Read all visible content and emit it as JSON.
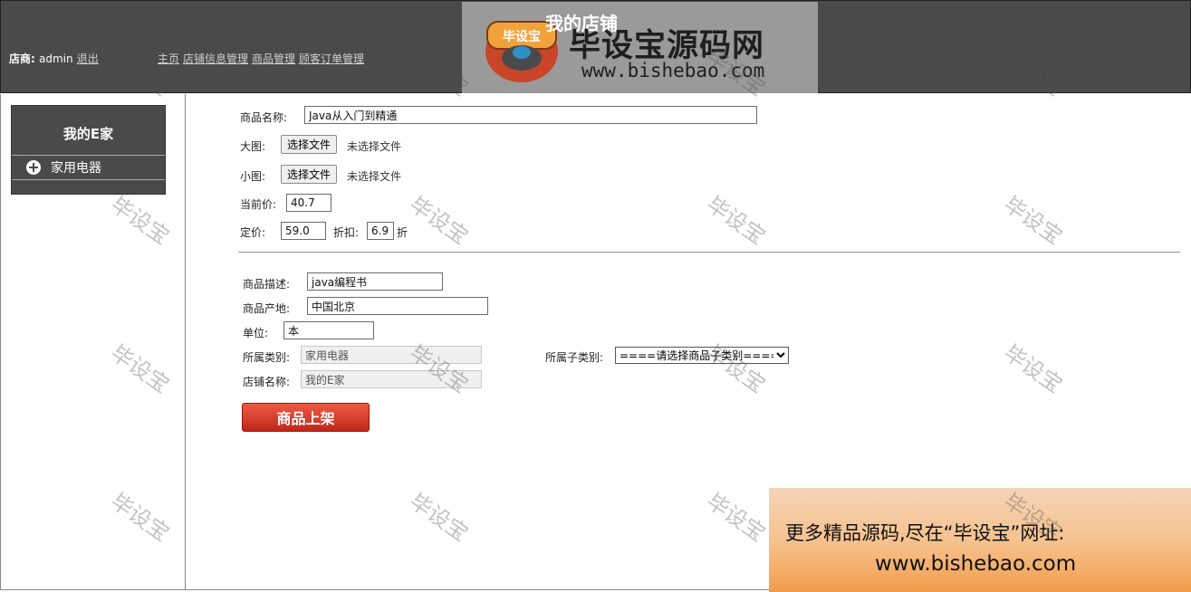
{
  "header": {
    "merchant_label": "店商:",
    "merchant_name": "admin",
    "logout_link": "退出",
    "nav": [
      "主页",
      "店铺信息管理",
      "商品管理",
      "顾客订单管理"
    ],
    "site_title": "我的店铺",
    "logo": {
      "badge_text": "毕设宝",
      "name": "毕设宝源码网",
      "url": "www.bishebao.com"
    }
  },
  "sidebar": {
    "shop_title": "我的E家",
    "categories": [
      "家用电器"
    ]
  },
  "form": {
    "name_label": "商品名称:",
    "name_value": "Java从入门到精通",
    "big_image_label": "大图:",
    "small_image_label": "小图:",
    "file_button": "选择文件",
    "no_file_text": "未选择文件",
    "current_price_label": "当前价:",
    "current_price_value": "40.7",
    "list_price_label": "定价:",
    "list_price_value": "59.0",
    "discount_label": "折扣:",
    "discount_value": "6.9",
    "discount_unit": "折",
    "desc_label": "商品描述:",
    "desc_value": "java编程书",
    "origin_label": "商品产地:",
    "origin_value": "中国北京",
    "unit_label": "单位:",
    "unit_value": "本",
    "category_label": "所属类别:",
    "category_value": "家用电器",
    "subcategory_label": "所属子类别:",
    "subcategory_selected": "====请选择商品子类别====",
    "shop_name_label": "店铺名称:",
    "shop_name_value": "我的E家",
    "submit_label": "商品上架"
  },
  "watermark": "毕设宝",
  "ad_banner": {
    "line1": "更多精品源码,尽在“毕设宝”网址:",
    "line2": "www.bishebao.com"
  }
}
